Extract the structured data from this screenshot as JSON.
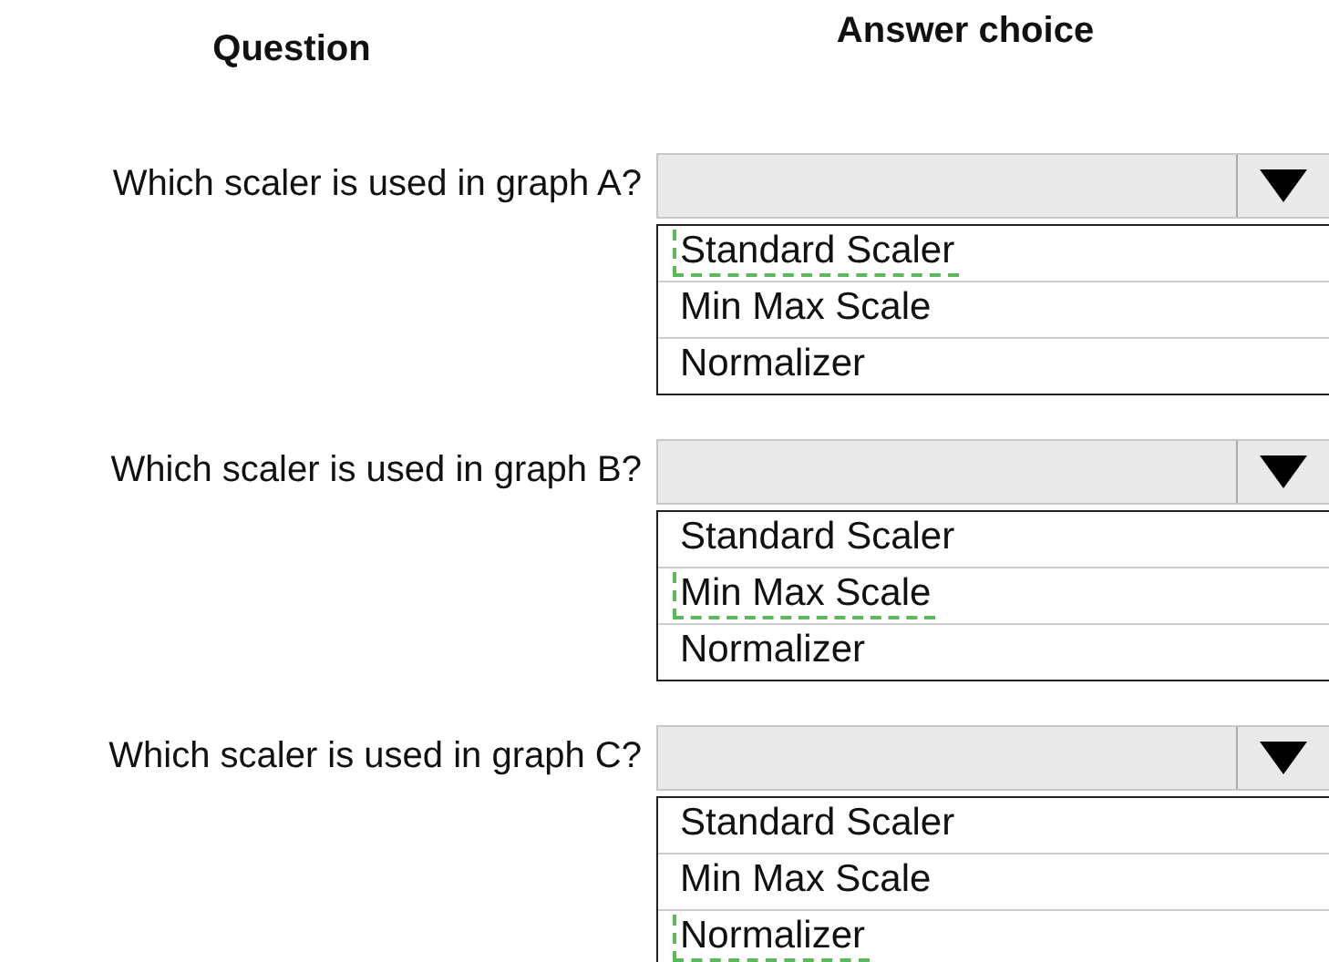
{
  "headers": {
    "question": "Question",
    "answer": "Answer choice"
  },
  "questions": [
    {
      "text": "Which scaler is used in graph A?",
      "options": [
        {
          "label": "Standard Scaler",
          "selected": true
        },
        {
          "label": "Min Max Scale",
          "selected": false
        },
        {
          "label": "Normalizer",
          "selected": false
        }
      ]
    },
    {
      "text": "Which scaler is used in graph B?",
      "options": [
        {
          "label": "Standard Scaler",
          "selected": false
        },
        {
          "label": "Min Max Scale",
          "selected": true
        },
        {
          "label": "Normalizer",
          "selected": false
        }
      ]
    },
    {
      "text": "Which scaler is used in graph C?",
      "options": [
        {
          "label": "Standard Scaler",
          "selected": false
        },
        {
          "label": "Min Max Scale",
          "selected": false
        },
        {
          "label": "Normalizer",
          "selected": true
        }
      ]
    }
  ]
}
